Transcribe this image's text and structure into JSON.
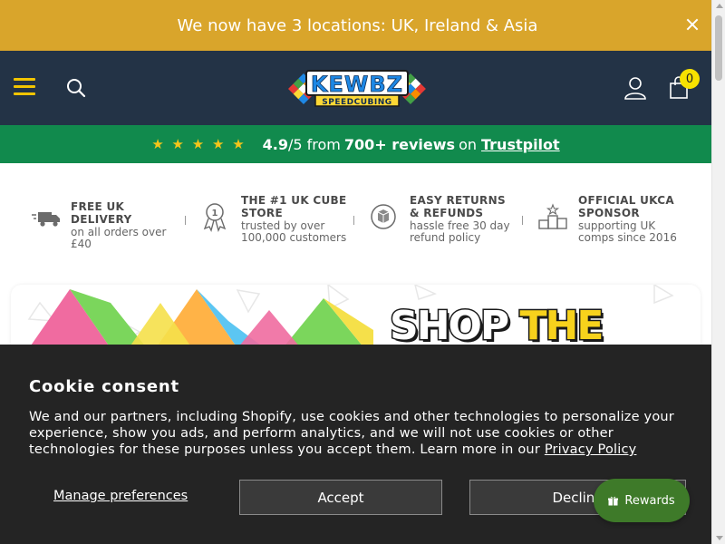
{
  "announcement": {
    "glyph": "",
    "text": "We now have 3 locations: UK, Ireland & Asia"
  },
  "header": {
    "logo_text": "KEWBZ",
    "logo_sub": "SPEEDCUBING",
    "cart_count": "0",
    "accent": "#f2c500",
    "bg": "#233346"
  },
  "trustbar": {
    "stars": "★ ★ ★ ★ ★",
    "rating": "4.9",
    "rating_suffix": "/5 from",
    "reviews": "700+ reviews",
    "on": "on",
    "link": "Trustpilot",
    "bg": "#118a4d"
  },
  "usps": [
    {
      "icon": "truck-icon",
      "title": "FREE UK DELIVERY",
      "sub": "on all orders over £40"
    },
    {
      "icon": "award-icon",
      "title": "THE #1 UK CUBE STORE",
      "sub": "trusted by over 100,000 customers"
    },
    {
      "icon": "return-box-icon",
      "title": "EASY RETURNS & REFUNDS",
      "sub": "hassle free 30 day refund policy"
    },
    {
      "icon": "podium-icon",
      "title": "OFFICIAL UKCA SPONSOR",
      "sub": "supporting UK comps since 2016"
    }
  ],
  "hero": {
    "word1": "SHOP",
    "word2": "THE UK'S"
  },
  "cookie": {
    "title": "Cookie consent",
    "body": "We and our partners, including Shopify, use cookies and other technologies to personalize your experience, show you ads, and perform analytics, and we will not use cookies or other technologies for these purposes unless you accept them. Learn more in our",
    "policy_link": "Privacy Policy",
    "manage": "Manage preferences",
    "accept": "Accept",
    "decline": "Decline"
  },
  "rewards": {
    "label": "Rewards"
  }
}
